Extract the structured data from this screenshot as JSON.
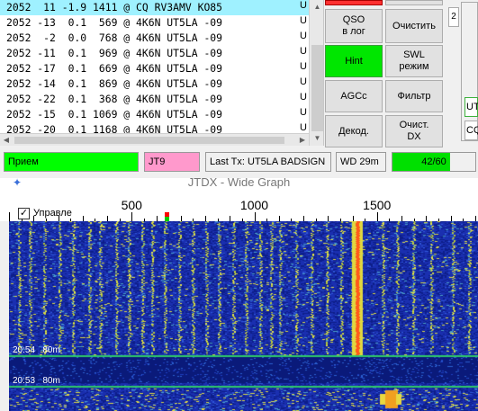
{
  "decode_lines": [
    {
      "text": "2052  11 -1.9 1411 @ CQ RV3AMV KO85",
      "highlight": true
    },
    {
      "text": "2052 -13  0.1  569 @ 4K6N UT5LA -09",
      "highlight": false
    },
    {
      "text": "2052  -2  0.0  768 @ 4K6N UT5LA -09",
      "highlight": false
    },
    {
      "text": "2052 -11  0.1  969 @ 4K6N UT5LA -09",
      "highlight": false
    },
    {
      "text": "2052 -17  0.1  669 @ 4K6N UT5LA -09",
      "highlight": false
    },
    {
      "text": "2052 -14  0.1  869 @ 4K6N UT5LA -09",
      "highlight": false
    },
    {
      "text": "2052 -22  0.1  368 @ 4K6N UT5LA -09",
      "highlight": false
    },
    {
      "text": "2052 -15  0.1 1069 @ 4K6N UT5LA -09",
      "highlight": false
    },
    {
      "text": "2052 -20  0.1 1168 @ 4K6N UT5LA -09",
      "highlight": false
    }
  ],
  "decode_edge_char": "U",
  "buttons": {
    "qso_log": "QSO\nв лог",
    "clear": "Очистить",
    "hint": "Hint",
    "swl_mode": "SWL\nрежим",
    "agcc": "AGCc",
    "filter": "Фильтр",
    "decode": "Декод.",
    "clear_dx": "Очист.\nDX"
  },
  "right_strip": {
    "tab_label": "2",
    "field1": "UT",
    "field2": "CQ"
  },
  "status": {
    "receive": "Прием",
    "mode": "JT9",
    "last_tx": "Last Tx: UT5LA BADSIGN",
    "wd": "WD 29m",
    "progress_text": "42/60",
    "progress_fraction": 0.7,
    "colors": {
      "green": "#00ff00",
      "pink": "#ff99cc"
    }
  },
  "wide_graph": {
    "title": "JTDX - Wide Graph",
    "control_label": "Управле",
    "control_checked": "✓",
    "freq_labels": [
      "500",
      "1000",
      "1500"
    ],
    "freqs": [
      500,
      1000,
      1500
    ],
    "freq_min": 0,
    "freq_max": 2000,
    "time_labels": [
      {
        "text": "20:54   80m"
      },
      {
        "text": "20:53   80m"
      }
    ],
    "markers": {
      "tx_color": "#00cc00",
      "rx_color": "#ff0000"
    }
  }
}
